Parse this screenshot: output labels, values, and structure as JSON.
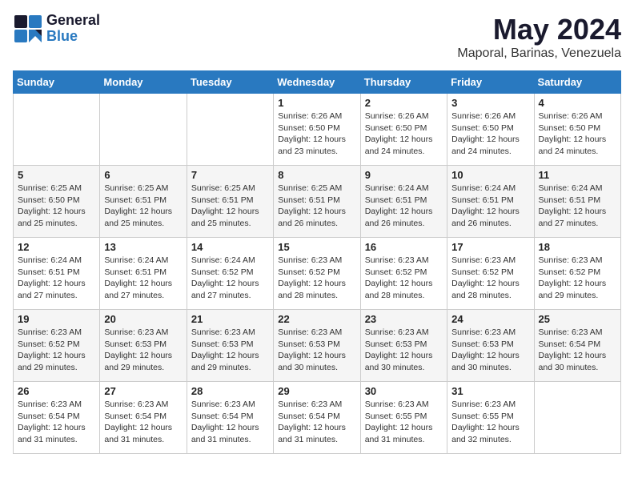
{
  "header": {
    "logo_general": "General",
    "logo_blue": "Blue",
    "month_year": "May 2024",
    "location": "Maporal, Barinas, Venezuela"
  },
  "weekdays": [
    "Sunday",
    "Monday",
    "Tuesday",
    "Wednesday",
    "Thursday",
    "Friday",
    "Saturday"
  ],
  "weeks": [
    [
      {
        "day": "",
        "info": ""
      },
      {
        "day": "",
        "info": ""
      },
      {
        "day": "",
        "info": ""
      },
      {
        "day": "1",
        "info": "Sunrise: 6:26 AM\nSunset: 6:50 PM\nDaylight: 12 hours\nand 23 minutes."
      },
      {
        "day": "2",
        "info": "Sunrise: 6:26 AM\nSunset: 6:50 PM\nDaylight: 12 hours\nand 24 minutes."
      },
      {
        "day": "3",
        "info": "Sunrise: 6:26 AM\nSunset: 6:50 PM\nDaylight: 12 hours\nand 24 minutes."
      },
      {
        "day": "4",
        "info": "Sunrise: 6:26 AM\nSunset: 6:50 PM\nDaylight: 12 hours\nand 24 minutes."
      }
    ],
    [
      {
        "day": "5",
        "info": "Sunrise: 6:25 AM\nSunset: 6:50 PM\nDaylight: 12 hours\nand 25 minutes."
      },
      {
        "day": "6",
        "info": "Sunrise: 6:25 AM\nSunset: 6:51 PM\nDaylight: 12 hours\nand 25 minutes."
      },
      {
        "day": "7",
        "info": "Sunrise: 6:25 AM\nSunset: 6:51 PM\nDaylight: 12 hours\nand 25 minutes."
      },
      {
        "day": "8",
        "info": "Sunrise: 6:25 AM\nSunset: 6:51 PM\nDaylight: 12 hours\nand 26 minutes."
      },
      {
        "day": "9",
        "info": "Sunrise: 6:24 AM\nSunset: 6:51 PM\nDaylight: 12 hours\nand 26 minutes."
      },
      {
        "day": "10",
        "info": "Sunrise: 6:24 AM\nSunset: 6:51 PM\nDaylight: 12 hours\nand 26 minutes."
      },
      {
        "day": "11",
        "info": "Sunrise: 6:24 AM\nSunset: 6:51 PM\nDaylight: 12 hours\nand 27 minutes."
      }
    ],
    [
      {
        "day": "12",
        "info": "Sunrise: 6:24 AM\nSunset: 6:51 PM\nDaylight: 12 hours\nand 27 minutes."
      },
      {
        "day": "13",
        "info": "Sunrise: 6:24 AM\nSunset: 6:51 PM\nDaylight: 12 hours\nand 27 minutes."
      },
      {
        "day": "14",
        "info": "Sunrise: 6:24 AM\nSunset: 6:52 PM\nDaylight: 12 hours\nand 27 minutes."
      },
      {
        "day": "15",
        "info": "Sunrise: 6:23 AM\nSunset: 6:52 PM\nDaylight: 12 hours\nand 28 minutes."
      },
      {
        "day": "16",
        "info": "Sunrise: 6:23 AM\nSunset: 6:52 PM\nDaylight: 12 hours\nand 28 minutes."
      },
      {
        "day": "17",
        "info": "Sunrise: 6:23 AM\nSunset: 6:52 PM\nDaylight: 12 hours\nand 28 minutes."
      },
      {
        "day": "18",
        "info": "Sunrise: 6:23 AM\nSunset: 6:52 PM\nDaylight: 12 hours\nand 29 minutes."
      }
    ],
    [
      {
        "day": "19",
        "info": "Sunrise: 6:23 AM\nSunset: 6:52 PM\nDaylight: 12 hours\nand 29 minutes."
      },
      {
        "day": "20",
        "info": "Sunrise: 6:23 AM\nSunset: 6:53 PM\nDaylight: 12 hours\nand 29 minutes."
      },
      {
        "day": "21",
        "info": "Sunrise: 6:23 AM\nSunset: 6:53 PM\nDaylight: 12 hours\nand 29 minutes."
      },
      {
        "day": "22",
        "info": "Sunrise: 6:23 AM\nSunset: 6:53 PM\nDaylight: 12 hours\nand 30 minutes."
      },
      {
        "day": "23",
        "info": "Sunrise: 6:23 AM\nSunset: 6:53 PM\nDaylight: 12 hours\nand 30 minutes."
      },
      {
        "day": "24",
        "info": "Sunrise: 6:23 AM\nSunset: 6:53 PM\nDaylight: 12 hours\nand 30 minutes."
      },
      {
        "day": "25",
        "info": "Sunrise: 6:23 AM\nSunset: 6:54 PM\nDaylight: 12 hours\nand 30 minutes."
      }
    ],
    [
      {
        "day": "26",
        "info": "Sunrise: 6:23 AM\nSunset: 6:54 PM\nDaylight: 12 hours\nand 31 minutes."
      },
      {
        "day": "27",
        "info": "Sunrise: 6:23 AM\nSunset: 6:54 PM\nDaylight: 12 hours\nand 31 minutes."
      },
      {
        "day": "28",
        "info": "Sunrise: 6:23 AM\nSunset: 6:54 PM\nDaylight: 12 hours\nand 31 minutes."
      },
      {
        "day": "29",
        "info": "Sunrise: 6:23 AM\nSunset: 6:54 PM\nDaylight: 12 hours\nand 31 minutes."
      },
      {
        "day": "30",
        "info": "Sunrise: 6:23 AM\nSunset: 6:55 PM\nDaylight: 12 hours\nand 31 minutes."
      },
      {
        "day": "31",
        "info": "Sunrise: 6:23 AM\nSunset: 6:55 PM\nDaylight: 12 hours\nand 32 minutes."
      },
      {
        "day": "",
        "info": ""
      }
    ]
  ]
}
